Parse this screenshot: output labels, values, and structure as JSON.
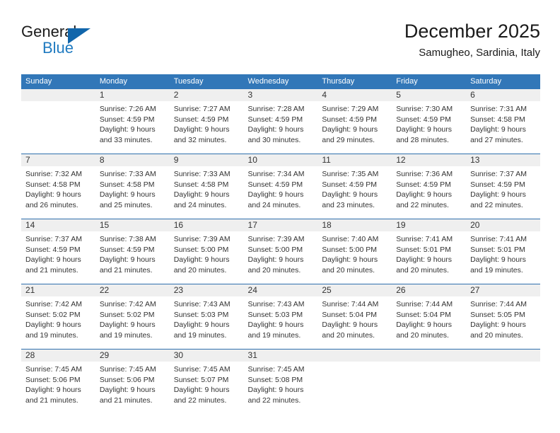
{
  "brand": {
    "line1": "General",
    "line2": "Blue",
    "logo_icon": "triangle-flag-icon",
    "accent_color": "#1166ab"
  },
  "header": {
    "title": "December 2025",
    "subtitle": "Samugheo, Sardinia, Italy"
  },
  "colors": {
    "header_blue": "#3277b8",
    "daynum_band": "#efefef",
    "row_divider": "#2f6fad",
    "text": "#333333"
  },
  "weekday_headers": [
    "Sunday",
    "Monday",
    "Tuesday",
    "Wednesday",
    "Thursday",
    "Friday",
    "Saturday"
  ],
  "weeks": [
    [
      {
        "day": "",
        "lines": []
      },
      {
        "day": "1",
        "lines": [
          "Sunrise: 7:26 AM",
          "Sunset: 4:59 PM",
          "Daylight: 9 hours",
          "and 33 minutes."
        ]
      },
      {
        "day": "2",
        "lines": [
          "Sunrise: 7:27 AM",
          "Sunset: 4:59 PM",
          "Daylight: 9 hours",
          "and 32 minutes."
        ]
      },
      {
        "day": "3",
        "lines": [
          "Sunrise: 7:28 AM",
          "Sunset: 4:59 PM",
          "Daylight: 9 hours",
          "and 30 minutes."
        ]
      },
      {
        "day": "4",
        "lines": [
          "Sunrise: 7:29 AM",
          "Sunset: 4:59 PM",
          "Daylight: 9 hours",
          "and 29 minutes."
        ]
      },
      {
        "day": "5",
        "lines": [
          "Sunrise: 7:30 AM",
          "Sunset: 4:59 PM",
          "Daylight: 9 hours",
          "and 28 minutes."
        ]
      },
      {
        "day": "6",
        "lines": [
          "Sunrise: 7:31 AM",
          "Sunset: 4:58 PM",
          "Daylight: 9 hours",
          "and 27 minutes."
        ]
      }
    ],
    [
      {
        "day": "7",
        "lines": [
          "Sunrise: 7:32 AM",
          "Sunset: 4:58 PM",
          "Daylight: 9 hours",
          "and 26 minutes."
        ]
      },
      {
        "day": "8",
        "lines": [
          "Sunrise: 7:33 AM",
          "Sunset: 4:58 PM",
          "Daylight: 9 hours",
          "and 25 minutes."
        ]
      },
      {
        "day": "9",
        "lines": [
          "Sunrise: 7:33 AM",
          "Sunset: 4:58 PM",
          "Daylight: 9 hours",
          "and 24 minutes."
        ]
      },
      {
        "day": "10",
        "lines": [
          "Sunrise: 7:34 AM",
          "Sunset: 4:59 PM",
          "Daylight: 9 hours",
          "and 24 minutes."
        ]
      },
      {
        "day": "11",
        "lines": [
          "Sunrise: 7:35 AM",
          "Sunset: 4:59 PM",
          "Daylight: 9 hours",
          "and 23 minutes."
        ]
      },
      {
        "day": "12",
        "lines": [
          "Sunrise: 7:36 AM",
          "Sunset: 4:59 PM",
          "Daylight: 9 hours",
          "and 22 minutes."
        ]
      },
      {
        "day": "13",
        "lines": [
          "Sunrise: 7:37 AM",
          "Sunset: 4:59 PM",
          "Daylight: 9 hours",
          "and 22 minutes."
        ]
      }
    ],
    [
      {
        "day": "14",
        "lines": [
          "Sunrise: 7:37 AM",
          "Sunset: 4:59 PM",
          "Daylight: 9 hours",
          "and 21 minutes."
        ]
      },
      {
        "day": "15",
        "lines": [
          "Sunrise: 7:38 AM",
          "Sunset: 4:59 PM",
          "Daylight: 9 hours",
          "and 21 minutes."
        ]
      },
      {
        "day": "16",
        "lines": [
          "Sunrise: 7:39 AM",
          "Sunset: 5:00 PM",
          "Daylight: 9 hours",
          "and 20 minutes."
        ]
      },
      {
        "day": "17",
        "lines": [
          "Sunrise: 7:39 AM",
          "Sunset: 5:00 PM",
          "Daylight: 9 hours",
          "and 20 minutes."
        ]
      },
      {
        "day": "18",
        "lines": [
          "Sunrise: 7:40 AM",
          "Sunset: 5:00 PM",
          "Daylight: 9 hours",
          "and 20 minutes."
        ]
      },
      {
        "day": "19",
        "lines": [
          "Sunrise: 7:41 AM",
          "Sunset: 5:01 PM",
          "Daylight: 9 hours",
          "and 20 minutes."
        ]
      },
      {
        "day": "20",
        "lines": [
          "Sunrise: 7:41 AM",
          "Sunset: 5:01 PM",
          "Daylight: 9 hours",
          "and 19 minutes."
        ]
      }
    ],
    [
      {
        "day": "21",
        "lines": [
          "Sunrise: 7:42 AM",
          "Sunset: 5:02 PM",
          "Daylight: 9 hours",
          "and 19 minutes."
        ]
      },
      {
        "day": "22",
        "lines": [
          "Sunrise: 7:42 AM",
          "Sunset: 5:02 PM",
          "Daylight: 9 hours",
          "and 19 minutes."
        ]
      },
      {
        "day": "23",
        "lines": [
          "Sunrise: 7:43 AM",
          "Sunset: 5:03 PM",
          "Daylight: 9 hours",
          "and 19 minutes."
        ]
      },
      {
        "day": "24",
        "lines": [
          "Sunrise: 7:43 AM",
          "Sunset: 5:03 PM",
          "Daylight: 9 hours",
          "and 19 minutes."
        ]
      },
      {
        "day": "25",
        "lines": [
          "Sunrise: 7:44 AM",
          "Sunset: 5:04 PM",
          "Daylight: 9 hours",
          "and 20 minutes."
        ]
      },
      {
        "day": "26",
        "lines": [
          "Sunrise: 7:44 AM",
          "Sunset: 5:04 PM",
          "Daylight: 9 hours",
          "and 20 minutes."
        ]
      },
      {
        "day": "27",
        "lines": [
          "Sunrise: 7:44 AM",
          "Sunset: 5:05 PM",
          "Daylight: 9 hours",
          "and 20 minutes."
        ]
      }
    ],
    [
      {
        "day": "28",
        "lines": [
          "Sunrise: 7:45 AM",
          "Sunset: 5:06 PM",
          "Daylight: 9 hours",
          "and 21 minutes."
        ]
      },
      {
        "day": "29",
        "lines": [
          "Sunrise: 7:45 AM",
          "Sunset: 5:06 PM",
          "Daylight: 9 hours",
          "and 21 minutes."
        ]
      },
      {
        "day": "30",
        "lines": [
          "Sunrise: 7:45 AM",
          "Sunset: 5:07 PM",
          "Daylight: 9 hours",
          "and 22 minutes."
        ]
      },
      {
        "day": "31",
        "lines": [
          "Sunrise: 7:45 AM",
          "Sunset: 5:08 PM",
          "Daylight: 9 hours",
          "and 22 minutes."
        ]
      },
      {
        "day": "",
        "lines": []
      },
      {
        "day": "",
        "lines": []
      },
      {
        "day": "",
        "lines": []
      }
    ]
  ]
}
